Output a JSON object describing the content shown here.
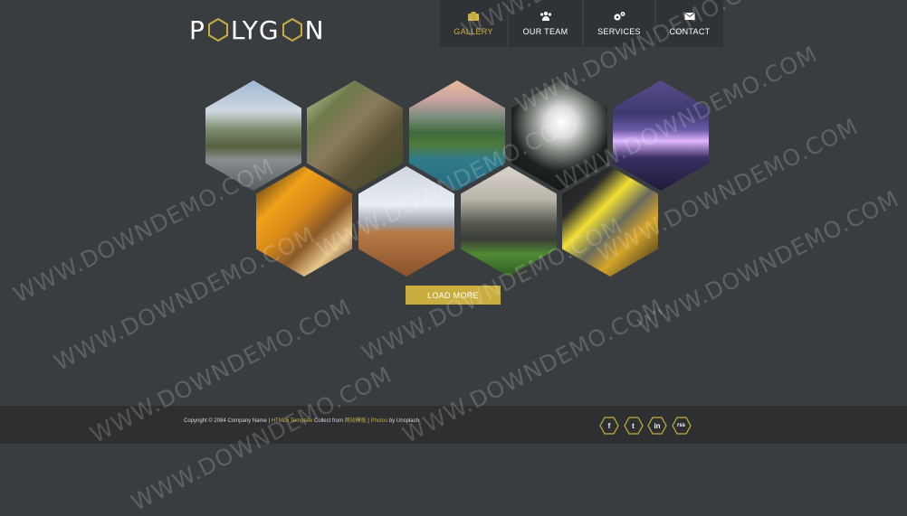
{
  "logo": {
    "prefix": "P",
    "middle": "LYG",
    "suffix": "N"
  },
  "nav": [
    {
      "label": "GALLERY",
      "icon": "camera-icon",
      "active": true
    },
    {
      "label": "OUR TEAM",
      "icon": "users-icon",
      "active": false
    },
    {
      "label": "SERVICES",
      "icon": "gears-icon",
      "active": false
    },
    {
      "label": "CONTACT",
      "icon": "envelope-icon",
      "active": false
    }
  ],
  "gallery": {
    "items": [
      {
        "name": "gallery-mountain-road"
      },
      {
        "name": "gallery-forest-rocks"
      },
      {
        "name": "gallery-lake-forest"
      },
      {
        "name": "gallery-dandelion"
      },
      {
        "name": "gallery-city-bridge-night"
      },
      {
        "name": "gallery-autumn-leaves"
      },
      {
        "name": "gallery-desk-glasses"
      },
      {
        "name": "gallery-rocks-grass"
      },
      {
        "name": "gallery-tea-press"
      }
    ]
  },
  "load_more": "LOAD MORE",
  "footer": {
    "copyright": "Copyright © 2084 Company Name | ",
    "template_link": "HTML5 Template",
    "collect": " Collect from ",
    "site_link": "网站模板",
    "sep": " | ",
    "photos_link": "Photos",
    "by": " by Unsplash"
  },
  "social": [
    {
      "icon": "facebook-icon",
      "glyph": "f"
    },
    {
      "icon": "twitter-icon",
      "glyph": "t"
    },
    {
      "icon": "linkedin-icon",
      "glyph": "in"
    },
    {
      "icon": "rss-icon",
      "glyph": "rss"
    }
  ],
  "watermark": "WWW.DOWNDEMO.COM",
  "colors": {
    "accent": "#c9ad3f",
    "background": "#3a3d40",
    "footer": "#2d2f31",
    "nav": "#303336"
  }
}
